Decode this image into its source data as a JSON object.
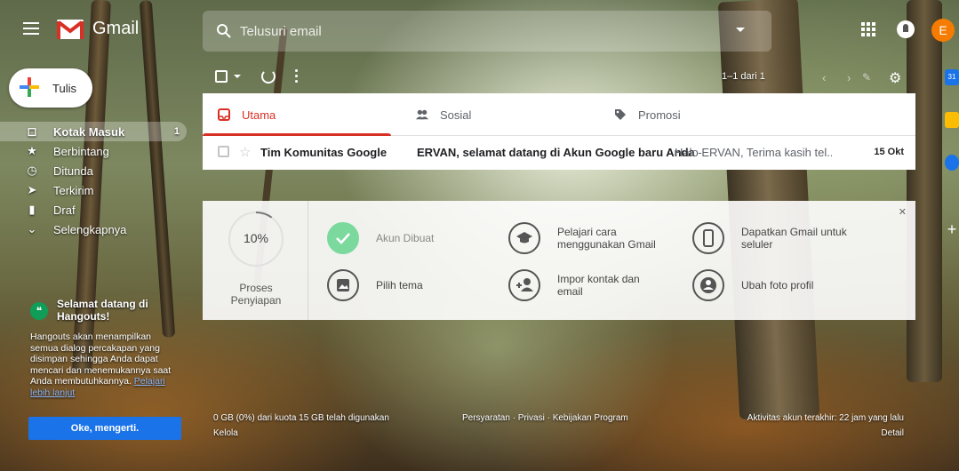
{
  "app": {
    "name": "Gmail",
    "user_initial": "E"
  },
  "search": {
    "placeholder": "Telusuri email"
  },
  "compose": {
    "label": "Tulis"
  },
  "nav": [
    {
      "label": "Kotak Masuk",
      "icon": "inbox-icon",
      "count": "1",
      "active": true
    },
    {
      "label": "Berbintang",
      "icon": "star-icon",
      "count": ""
    },
    {
      "label": "Ditunda",
      "icon": "clock-icon",
      "count": ""
    },
    {
      "label": "Terkirim",
      "icon": "send-icon",
      "count": ""
    },
    {
      "label": "Draf",
      "icon": "draft-icon",
      "count": ""
    },
    {
      "label": "Selengkapnya",
      "icon": "chevron-down-icon",
      "count": ""
    }
  ],
  "hangouts": {
    "title": "Selamat datang di Hangouts!",
    "text": "Hangouts akan menampilkan semua dialog percakapan yang disimpan sehingga Anda dapat mencari dan menemukannya saat Anda membutuhkannya.",
    "link": "Pelajari lebih lanjut",
    "ok_button": "Oke, mengerti."
  },
  "toolbar": {
    "range": "1–1 dari 1"
  },
  "tabs": [
    {
      "label": "Utama",
      "icon": "inbox-tab-icon",
      "active": true
    },
    {
      "label": "Sosial",
      "icon": "people-icon",
      "active": false
    },
    {
      "label": "Promosi",
      "icon": "tag-icon",
      "active": false
    }
  ],
  "emails": [
    {
      "sender": "Tim Komunitas Google",
      "subject": "ERVAN, selamat datang di Akun Google baru Anda",
      "separator": " - ",
      "snippet": "Halo ERVAN, Terima kasih tel...",
      "date": "15 Okt",
      "starred": false
    }
  ],
  "setup": {
    "progress_value": "10%",
    "progress_fraction": 0.1,
    "progress_label": "Proses Penyiapan",
    "items": [
      {
        "label": "Akun Dibuat",
        "icon": "check-icon",
        "done": true
      },
      {
        "label": "Pilih tema",
        "icon": "image-icon",
        "done": false
      },
      {
        "label": "Pelajari cara menggunakan Gmail",
        "icon": "school-icon",
        "done": false
      },
      {
        "label": "Impor kontak dan email",
        "icon": "add-person-icon",
        "done": false
      },
      {
        "label": "Dapatkan Gmail untuk seluler",
        "icon": "phone-icon",
        "done": false
      },
      {
        "label": "Ubah foto profil",
        "icon": "account-icon",
        "done": false
      }
    ]
  },
  "footer": {
    "quota": "0 GB (0%) dari kuota 15 GB telah digunakan",
    "manage": "Kelola",
    "terms": "Persyaratan · Privasi · Kebijakan Program",
    "activity": "Aktivitas akun terakhir: 22 jam yang lalu",
    "details": "Detail"
  },
  "colors": {
    "accent_red": "#d93025",
    "compose_blue": "#1a73e8",
    "done_green": "#7cd99e",
    "avatar_orange": "#f57c00"
  }
}
